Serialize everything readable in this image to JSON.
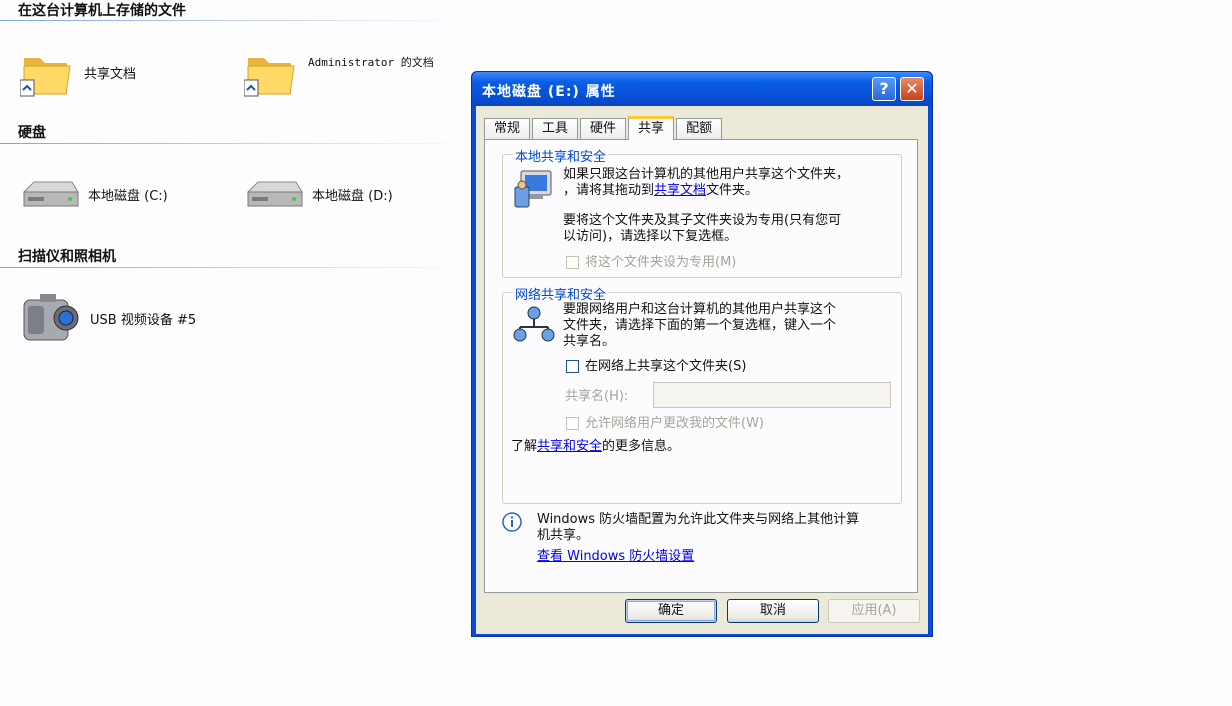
{
  "explorer": {
    "groups": [
      {
        "title": "在这台计算机上存储的文件"
      },
      {
        "title": "硬盘"
      },
      {
        "title": "扫描仪和照相机"
      }
    ],
    "files": [
      {
        "label": "共享文档",
        "icon": "folder-icon"
      },
      {
        "label": "Administrator 的文档",
        "icon": "folder-icon"
      }
    ],
    "drives": [
      {
        "label": "本地磁盘 (C:)",
        "icon": "hard-disk-icon"
      },
      {
        "label": "本地磁盘 (D:)",
        "icon": "hard-disk-icon"
      }
    ],
    "devices": [
      {
        "label": "USB 视频设备 #5",
        "icon": "camera-icon"
      }
    ]
  },
  "dialog": {
    "title": "本地磁盘 (E:) 属性",
    "help_label": "?",
    "close_label": "✕",
    "tabs": [
      {
        "label": "常规"
      },
      {
        "label": "工具"
      },
      {
        "label": "硬件"
      },
      {
        "label": "共享",
        "active": true
      },
      {
        "label": "配额"
      }
    ],
    "local": {
      "legend": "本地共享和安全",
      "p1a": "如果只跟这台计算机的其他用户共享这个文件夹，",
      "p1b_pre": "，请将其拖动到",
      "p1b_link": "共享文档",
      "p1b_post": "文件夹。",
      "p2a": "要将这个文件夹及其子文件夹设为专用(只有您可",
      "p2b": "以访问)，请选择以下复选框。",
      "private_checkbox": "将这个文件夹设为专用(M)"
    },
    "network": {
      "legend": "网络共享和安全",
      "p1a": "要跟网络用户和这台计算机的其他用户共享这个",
      "p1b": "文件夹，请选择下面的第一个复选框，键入一个",
      "p1c": "共享名。",
      "share_checkbox": "在网络上共享这个文件夹(S)",
      "share_name_label": "共享名(H):",
      "share_name_value": "",
      "allow_change_checkbox": "允许网络用户更改我的文件(W)",
      "learn_pre": "了解",
      "learn_link": "共享和安全",
      "learn_post": "的更多信息。"
    },
    "firewall": {
      "line1": "Windows 防火墙配置为允许此文件夹与网络上其他计算",
      "line2": "机共享。",
      "link": "查看 Windows 防火墙设置"
    },
    "buttons": {
      "ok": "确定",
      "cancel": "取消",
      "apply": "应用(A)"
    }
  }
}
